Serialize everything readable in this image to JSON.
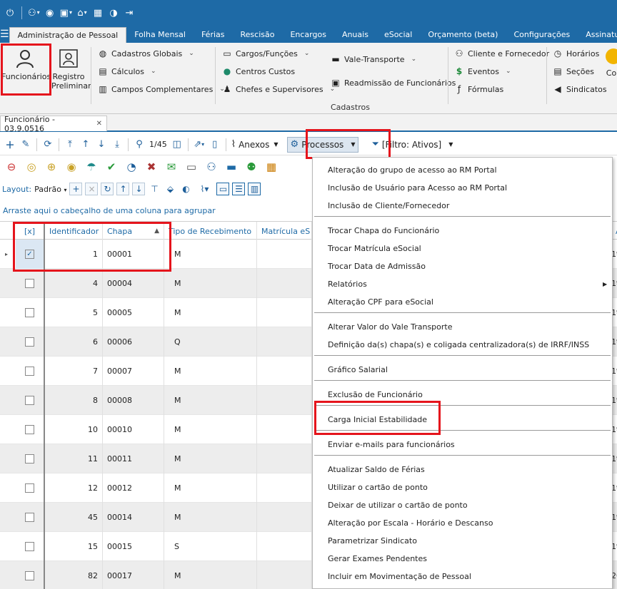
{
  "quick_access": {
    "items": [
      "power-icon",
      "users-icon",
      "eye-icon",
      "window-icon",
      "home-icon",
      "grid-icon",
      "globe-icon",
      "exit-icon"
    ]
  },
  "menu": {
    "tabs": [
      "Administração de Pessoal",
      "Folha Mensal",
      "Férias",
      "Rescisão",
      "Encargos",
      "Anuais",
      "eSocial",
      "Orçamento (beta)",
      "Configurações",
      "Assinatura El"
    ]
  },
  "ribbon": {
    "funcionarios": "Funcionários",
    "registro_line1": "Registro",
    "registro_line2": "Preliminar",
    "cadastros_globais": "Cadastros Globais",
    "calculos": "Cálculos",
    "campos_complementares": "Campos Complementares",
    "cargos_funcoes": "Cargos/Funções",
    "centros_custos": "Centros Custos",
    "chefes_supervisores": "Chefes e Supervisores",
    "vale_transporte": "Vale-Transporte",
    "readmissao": "Readmissão de Funcionários",
    "cliente_fornecedor": "Cliente e Fornecedor",
    "eventos": "Eventos",
    "formulas": "Fórmulas",
    "horarios": "Horários",
    "secoes": "Seções",
    "sindicatos": "Sindicatos",
    "co": "Co",
    "group_label": "Cadastros"
  },
  "doc_tab": {
    "title": "Funcionário - 03.9.0516",
    "close": "✕"
  },
  "toolbar": {
    "page": "1/45",
    "anexos": "Anexos",
    "processos": "Processos",
    "filtro": "[Filtro: Ativos]"
  },
  "layout_bar": {
    "label": "Layout:",
    "value": "Padrão"
  },
  "group_hint": "Arraste aqui o cabeçalho de uma coluna para agrupar",
  "grid": {
    "headers": {
      "check": "[x]",
      "identificador": "Identificador",
      "chapa": "Chapa",
      "tipo": "Tipo de Recebimento",
      "matricula": "Matrícula eS",
      "extra": "A"
    },
    "rows": [
      {
        "id": "1",
        "chapa": "00001",
        "tipo": "M",
        "checked": true,
        "edge": "1º"
      },
      {
        "id": "4",
        "chapa": "00004",
        "tipo": "M",
        "checked": false,
        "edge": "1º"
      },
      {
        "id": "5",
        "chapa": "00005",
        "tipo": "M",
        "checked": false,
        "edge": "1º"
      },
      {
        "id": "6",
        "chapa": "00006",
        "tipo": "Q",
        "checked": false,
        "edge": "1º"
      },
      {
        "id": "7",
        "chapa": "00007",
        "tipo": "M",
        "checked": false,
        "edge": "1º"
      },
      {
        "id": "8",
        "chapa": "00008",
        "tipo": "M",
        "checked": false,
        "edge": "1º"
      },
      {
        "id": "10",
        "chapa": "00010",
        "tipo": "M",
        "checked": false,
        "edge": "1º"
      },
      {
        "id": "11",
        "chapa": "00011",
        "tipo": "M",
        "checked": false,
        "edge": "1º"
      },
      {
        "id": "12",
        "chapa": "00012",
        "tipo": "M",
        "checked": false,
        "edge": "1º"
      },
      {
        "id": "45",
        "chapa": "00014",
        "tipo": "M",
        "checked": false,
        "edge": "1º"
      },
      {
        "id": "15",
        "chapa": "00015",
        "tipo": "S",
        "checked": false,
        "edge": "1º"
      },
      {
        "id": "82",
        "chapa": "00017",
        "tipo": "M",
        "checked": false,
        "edge": "20"
      }
    ]
  },
  "processos_menu": {
    "groups": [
      [
        "Alteração do grupo de acesso ao RM Portal",
        "Inclusão de Usuário para Acesso ao RM Portal",
        "Inclusão de Cliente/Fornecedor"
      ],
      [
        "Trocar Chapa do Funcionário",
        "Trocar Matrícula eSocial",
        "Trocar Data de Admissão",
        "Relatórios",
        "Alteração CPF para eSocial"
      ],
      [
        "Alterar Valor do Vale Transporte",
        "Definição da(s) chapa(s)  e coligada centralizadora(s) de IRRF/INSS"
      ],
      [
        "Gráfico Salarial"
      ],
      [
        "Exclusão de Funcionário"
      ],
      [
        "Carga Inicial Estabilidade"
      ],
      [
        "Enviar e-mails para funcionários"
      ],
      [
        "Atualizar Saldo de Férias",
        "Utilizar o cartão de ponto",
        "Deixar de utilizar o cartão de ponto",
        "Alteração por Escala - Horário e Descanso",
        "Parametrizar Sindicato",
        "Gerar Exames Pendentes",
        "Incluir em Movimentação de Pessoal"
      ]
    ],
    "submenu_arrow": "▶"
  },
  "colors": {
    "brand": "#1e6aa6",
    "highlight": "#e5141c"
  }
}
